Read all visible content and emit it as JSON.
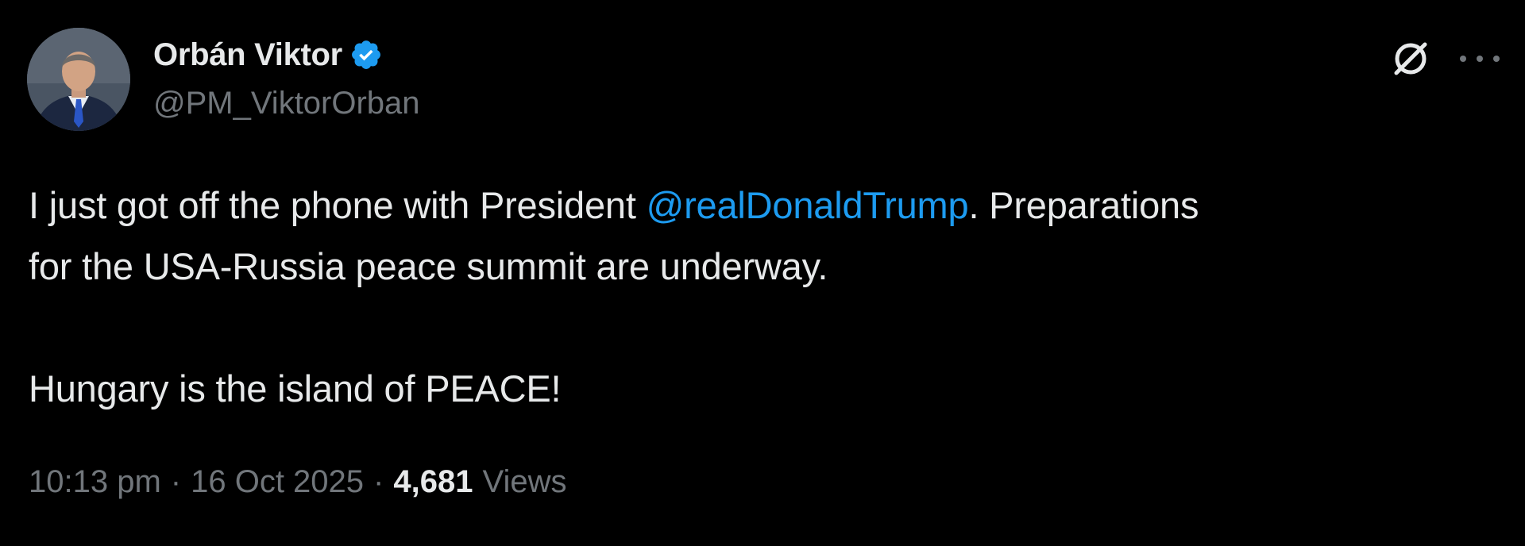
{
  "author": {
    "display_name": "Orbán Viktor",
    "handle": "@PM_ViktorOrban",
    "verified": true,
    "verified_badge_color": "#1d9bf0"
  },
  "actions": {
    "grok_icon": "grok-icon",
    "more_icon": "more-options-icon"
  },
  "tweet": {
    "line1_before": "I just got off the phone with President ",
    "mention": "@realDonaldTrump",
    "line1_after": ". Preparations",
    "line2": "for the USA-Russia peace summit are underway.",
    "line3": "Hungary is the island of PEACE!"
  },
  "meta": {
    "time": "10:13 pm",
    "separator": "·",
    "date": "16 Oct 2025",
    "views_count": "4,681",
    "views_label": "Views"
  },
  "colors": {
    "background": "#000000",
    "primary_text": "#e7e9ea",
    "secondary_text": "#71767b",
    "link": "#1d9bf0"
  }
}
